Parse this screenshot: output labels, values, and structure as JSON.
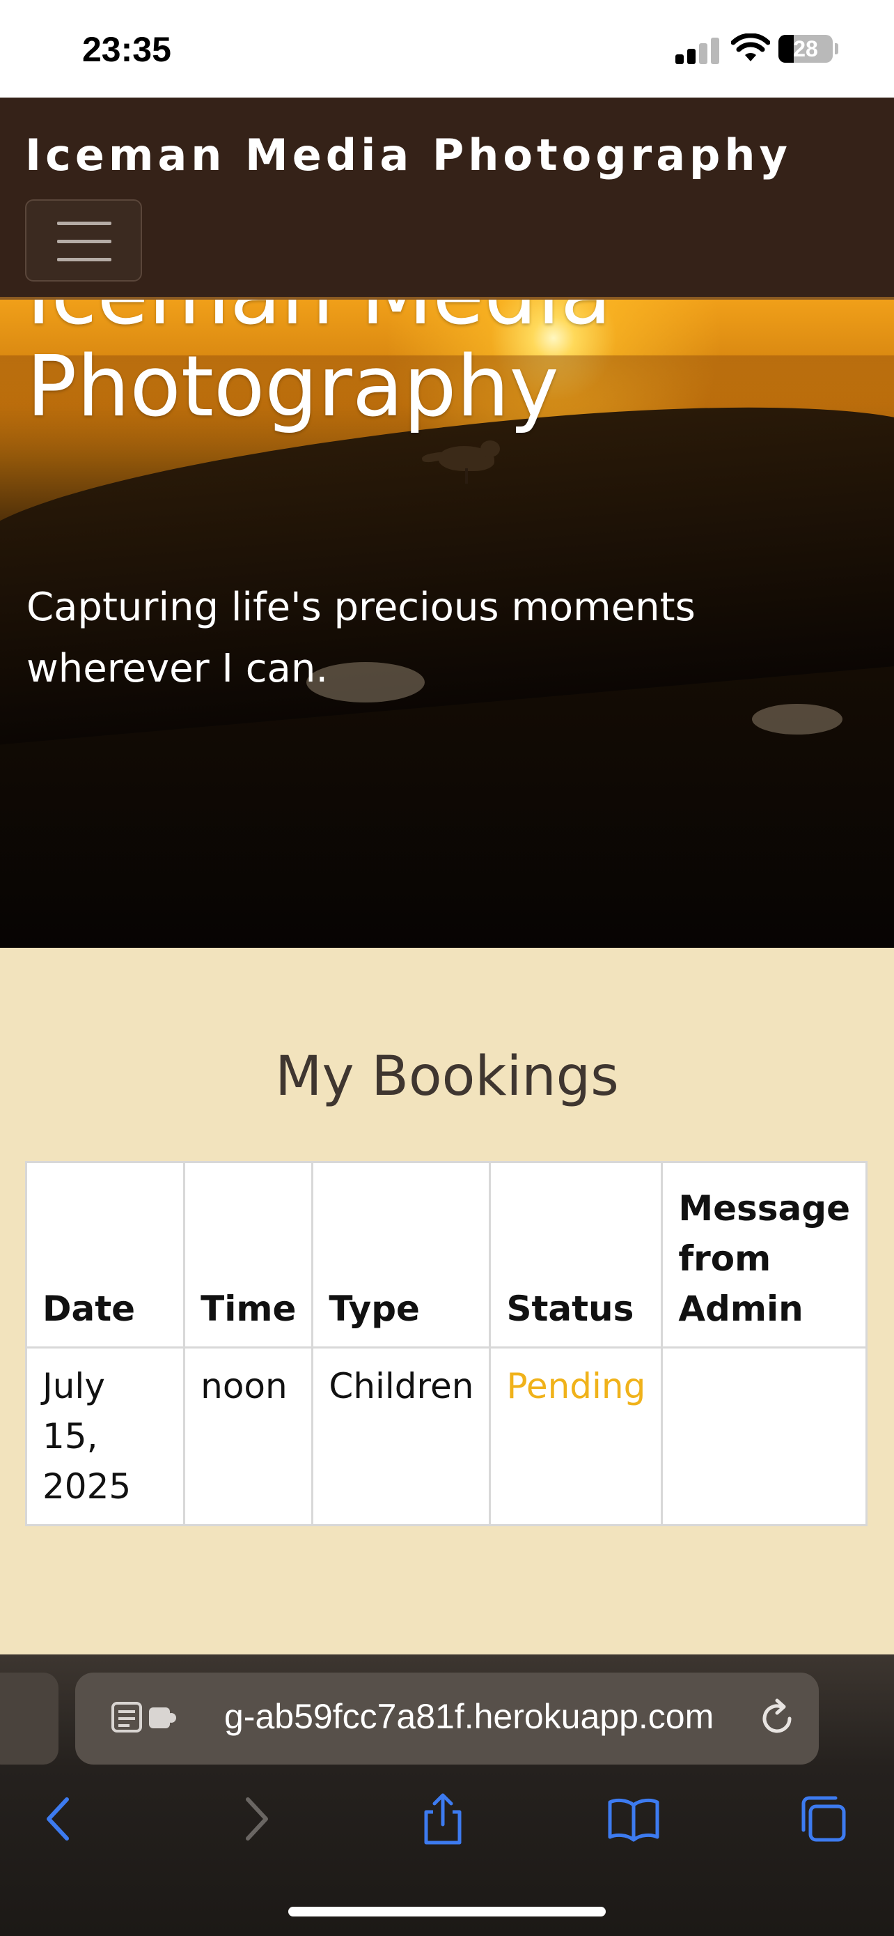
{
  "status_bar": {
    "time": "23:35",
    "battery_level": "28",
    "icons": [
      "signal-icon",
      "wifi-icon",
      "battery-icon"
    ]
  },
  "navbar": {
    "brand": "Iceman Media Photography",
    "toggler_icon": "hamburger-menu-icon"
  },
  "hero": {
    "title_line1": "Iceman Media",
    "title_line2": "Photography",
    "subtitle": "Capturing life's precious moments wherever I can."
  },
  "bookings": {
    "title": "My Bookings",
    "columns": [
      "Date",
      "Time",
      "Type",
      "Status",
      "Message from Admin"
    ],
    "rows": [
      {
        "date": "July 15, 2025",
        "time": "noon",
        "type": "Children",
        "status": "Pending",
        "message": ""
      }
    ]
  },
  "colors": {
    "navbar_bg": "#352218",
    "page_bg": "#f2e3bd",
    "status_pending": "#f0b21a",
    "browser_accent": "#3d7bf0"
  },
  "browser": {
    "url": "g-ab59fcc7a81f.herokuapp.com",
    "icons": [
      "reader-mode-icon",
      "extension-icon",
      "reload-icon",
      "back-icon",
      "forward-icon",
      "share-icon",
      "bookmarks-icon",
      "tabs-icon"
    ]
  }
}
